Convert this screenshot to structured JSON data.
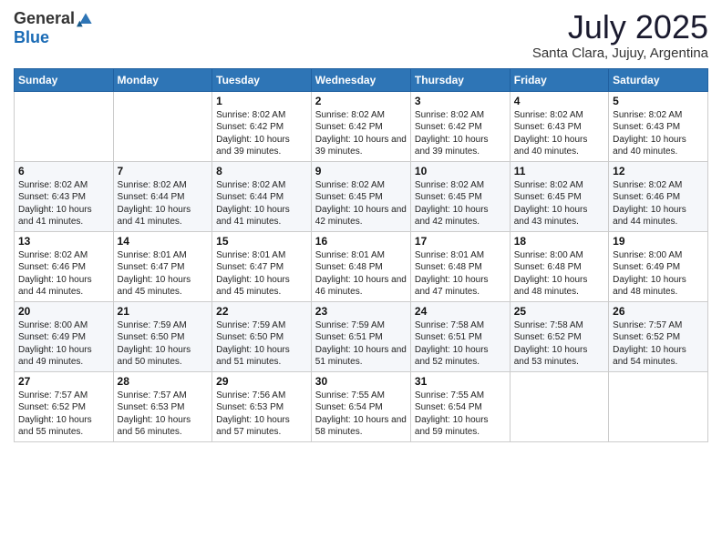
{
  "header": {
    "logo_general": "General",
    "logo_blue": "Blue",
    "month_title": "July 2025",
    "location": "Santa Clara, Jujuy, Argentina"
  },
  "weekdays": [
    "Sunday",
    "Monday",
    "Tuesday",
    "Wednesday",
    "Thursday",
    "Friday",
    "Saturday"
  ],
  "weeks": [
    [
      {
        "day": "",
        "sunrise": "",
        "sunset": "",
        "daylight": ""
      },
      {
        "day": "",
        "sunrise": "",
        "sunset": "",
        "daylight": ""
      },
      {
        "day": "1",
        "sunrise": "Sunrise: 8:02 AM",
        "sunset": "Sunset: 6:42 PM",
        "daylight": "Daylight: 10 hours and 39 minutes."
      },
      {
        "day": "2",
        "sunrise": "Sunrise: 8:02 AM",
        "sunset": "Sunset: 6:42 PM",
        "daylight": "Daylight: 10 hours and 39 minutes."
      },
      {
        "day": "3",
        "sunrise": "Sunrise: 8:02 AM",
        "sunset": "Sunset: 6:42 PM",
        "daylight": "Daylight: 10 hours and 39 minutes."
      },
      {
        "day": "4",
        "sunrise": "Sunrise: 8:02 AM",
        "sunset": "Sunset: 6:43 PM",
        "daylight": "Daylight: 10 hours and 40 minutes."
      },
      {
        "day": "5",
        "sunrise": "Sunrise: 8:02 AM",
        "sunset": "Sunset: 6:43 PM",
        "daylight": "Daylight: 10 hours and 40 minutes."
      }
    ],
    [
      {
        "day": "6",
        "sunrise": "Sunrise: 8:02 AM",
        "sunset": "Sunset: 6:43 PM",
        "daylight": "Daylight: 10 hours and 41 minutes."
      },
      {
        "day": "7",
        "sunrise": "Sunrise: 8:02 AM",
        "sunset": "Sunset: 6:44 PM",
        "daylight": "Daylight: 10 hours and 41 minutes."
      },
      {
        "day": "8",
        "sunrise": "Sunrise: 8:02 AM",
        "sunset": "Sunset: 6:44 PM",
        "daylight": "Daylight: 10 hours and 41 minutes."
      },
      {
        "day": "9",
        "sunrise": "Sunrise: 8:02 AM",
        "sunset": "Sunset: 6:45 PM",
        "daylight": "Daylight: 10 hours and 42 minutes."
      },
      {
        "day": "10",
        "sunrise": "Sunrise: 8:02 AM",
        "sunset": "Sunset: 6:45 PM",
        "daylight": "Daylight: 10 hours and 42 minutes."
      },
      {
        "day": "11",
        "sunrise": "Sunrise: 8:02 AM",
        "sunset": "Sunset: 6:45 PM",
        "daylight": "Daylight: 10 hours and 43 minutes."
      },
      {
        "day": "12",
        "sunrise": "Sunrise: 8:02 AM",
        "sunset": "Sunset: 6:46 PM",
        "daylight": "Daylight: 10 hours and 44 minutes."
      }
    ],
    [
      {
        "day": "13",
        "sunrise": "Sunrise: 8:02 AM",
        "sunset": "Sunset: 6:46 PM",
        "daylight": "Daylight: 10 hours and 44 minutes."
      },
      {
        "day": "14",
        "sunrise": "Sunrise: 8:01 AM",
        "sunset": "Sunset: 6:47 PM",
        "daylight": "Daylight: 10 hours and 45 minutes."
      },
      {
        "day": "15",
        "sunrise": "Sunrise: 8:01 AM",
        "sunset": "Sunset: 6:47 PM",
        "daylight": "Daylight: 10 hours and 45 minutes."
      },
      {
        "day": "16",
        "sunrise": "Sunrise: 8:01 AM",
        "sunset": "Sunset: 6:48 PM",
        "daylight": "Daylight: 10 hours and 46 minutes."
      },
      {
        "day": "17",
        "sunrise": "Sunrise: 8:01 AM",
        "sunset": "Sunset: 6:48 PM",
        "daylight": "Daylight: 10 hours and 47 minutes."
      },
      {
        "day": "18",
        "sunrise": "Sunrise: 8:00 AM",
        "sunset": "Sunset: 6:48 PM",
        "daylight": "Daylight: 10 hours and 48 minutes."
      },
      {
        "day": "19",
        "sunrise": "Sunrise: 8:00 AM",
        "sunset": "Sunset: 6:49 PM",
        "daylight": "Daylight: 10 hours and 48 minutes."
      }
    ],
    [
      {
        "day": "20",
        "sunrise": "Sunrise: 8:00 AM",
        "sunset": "Sunset: 6:49 PM",
        "daylight": "Daylight: 10 hours and 49 minutes."
      },
      {
        "day": "21",
        "sunrise": "Sunrise: 7:59 AM",
        "sunset": "Sunset: 6:50 PM",
        "daylight": "Daylight: 10 hours and 50 minutes."
      },
      {
        "day": "22",
        "sunrise": "Sunrise: 7:59 AM",
        "sunset": "Sunset: 6:50 PM",
        "daylight": "Daylight: 10 hours and 51 minutes."
      },
      {
        "day": "23",
        "sunrise": "Sunrise: 7:59 AM",
        "sunset": "Sunset: 6:51 PM",
        "daylight": "Daylight: 10 hours and 51 minutes."
      },
      {
        "day": "24",
        "sunrise": "Sunrise: 7:58 AM",
        "sunset": "Sunset: 6:51 PM",
        "daylight": "Daylight: 10 hours and 52 minutes."
      },
      {
        "day": "25",
        "sunrise": "Sunrise: 7:58 AM",
        "sunset": "Sunset: 6:52 PM",
        "daylight": "Daylight: 10 hours and 53 minutes."
      },
      {
        "day": "26",
        "sunrise": "Sunrise: 7:57 AM",
        "sunset": "Sunset: 6:52 PM",
        "daylight": "Daylight: 10 hours and 54 minutes."
      }
    ],
    [
      {
        "day": "27",
        "sunrise": "Sunrise: 7:57 AM",
        "sunset": "Sunset: 6:52 PM",
        "daylight": "Daylight: 10 hours and 55 minutes."
      },
      {
        "day": "28",
        "sunrise": "Sunrise: 7:57 AM",
        "sunset": "Sunset: 6:53 PM",
        "daylight": "Daylight: 10 hours and 56 minutes."
      },
      {
        "day": "29",
        "sunrise": "Sunrise: 7:56 AM",
        "sunset": "Sunset: 6:53 PM",
        "daylight": "Daylight: 10 hours and 57 minutes."
      },
      {
        "day": "30",
        "sunrise": "Sunrise: 7:55 AM",
        "sunset": "Sunset: 6:54 PM",
        "daylight": "Daylight: 10 hours and 58 minutes."
      },
      {
        "day": "31",
        "sunrise": "Sunrise: 7:55 AM",
        "sunset": "Sunset: 6:54 PM",
        "daylight": "Daylight: 10 hours and 59 minutes."
      },
      {
        "day": "",
        "sunrise": "",
        "sunset": "",
        "daylight": ""
      },
      {
        "day": "",
        "sunrise": "",
        "sunset": "",
        "daylight": ""
      }
    ]
  ]
}
